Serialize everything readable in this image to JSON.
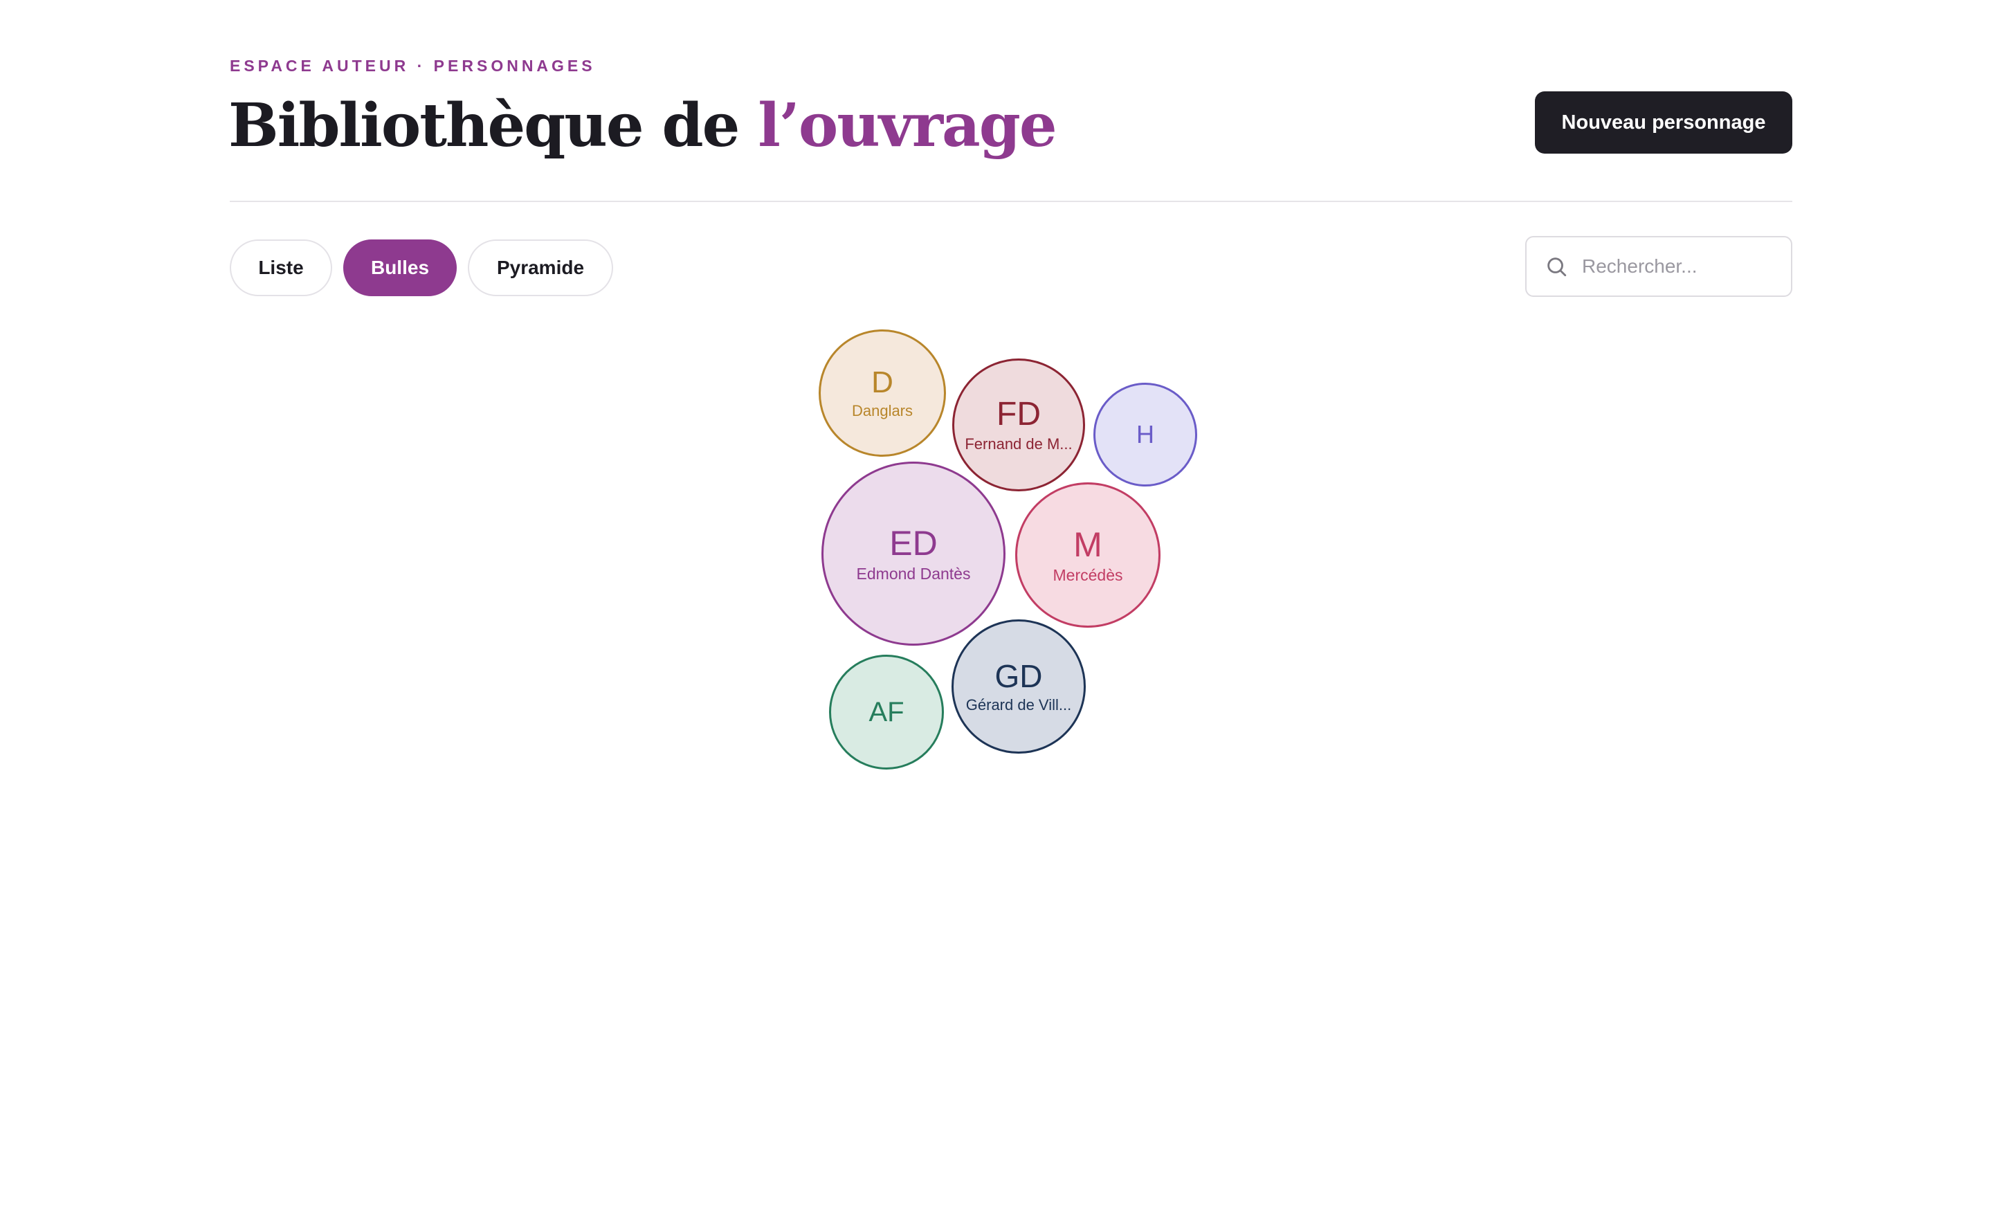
{
  "header": {
    "eyebrow": "ESPACE AUTEUR · PERSONNAGES",
    "title_main": "Bibliothèque de ",
    "title_accent": "l’ouvrage",
    "new_button_label": "Nouveau personnage"
  },
  "view_tabs": [
    {
      "label": "Liste",
      "active": false
    },
    {
      "label": "Bulles",
      "active": true
    },
    {
      "label": "Pyramide",
      "active": false
    }
  ],
  "search": {
    "placeholder": "Rechercher...",
    "value": "",
    "icon": "search-icon"
  },
  "colors": {
    "accent": "#8e3a8f",
    "dark": "#1f1e25"
  },
  "characters": [
    {
      "initials": "D",
      "name": "Danglars",
      "color": "#b8862b",
      "fill": "#f5e8dc"
    },
    {
      "initials": "FD",
      "name": "Fernand de M...",
      "color": "#8c2433",
      "fill": "#efdbdd"
    },
    {
      "initials": "H",
      "name": "",
      "color": "#6a5cc8",
      "fill": "#e3e2f7"
    },
    {
      "initials": "ED",
      "name": "Edmond Dantès",
      "color": "#8e3a8f",
      "fill": "#ecdcec"
    },
    {
      "initials": "M",
      "name": "Mercédès",
      "color": "#c23d64",
      "fill": "#f7dbe2"
    },
    {
      "initials": "AF",
      "name": "",
      "color": "#267d5c",
      "fill": "#d9ebe3"
    },
    {
      "initials": "GD",
      "name": "Gérard de Vill...",
      "color": "#1d3456",
      "fill": "#d6dbe5"
    }
  ]
}
